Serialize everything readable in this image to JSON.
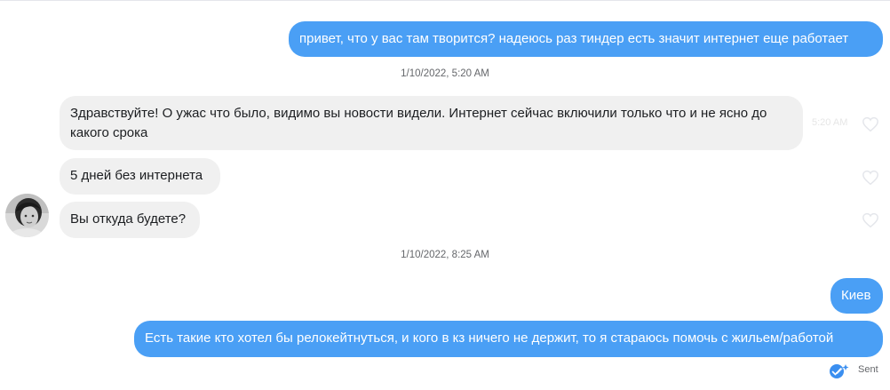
{
  "thread": {
    "messages": [
      {
        "direction": "outgoing",
        "text": "привет, что у вас там творится? надеюсь раз тиндер есть значит интернет еще работает"
      },
      {
        "type": "timestamp",
        "text": "1/10/2022, 5:20 AM"
      },
      {
        "direction": "incoming",
        "text": "Здравствуйте! О ужас что было, видимо вы новости видели. Интернет сейчас включили только что и не ясно до какого срока",
        "hover_time": "5:20 AM"
      },
      {
        "direction": "incoming",
        "text": "5 дней без интернета"
      },
      {
        "direction": "incoming",
        "text": "Вы откуда будете?"
      },
      {
        "type": "timestamp",
        "text": "1/10/2022, 8:25 AM"
      },
      {
        "direction": "outgoing",
        "text": "Киев"
      },
      {
        "direction": "outgoing",
        "text": "Есть такие кто хотел бы релокейтнуться, и кого в кз ничего не держит, то я стараюсь помочь с жильем/работой"
      }
    ],
    "status": {
      "label": "Sent",
      "icon": "double-check-icon"
    }
  },
  "colors": {
    "outgoing_bubble": "#4a9ff5",
    "incoming_bubble": "#f0f0f0",
    "timestamp_text": "#65676b",
    "status_icon": "#3b8ff0"
  }
}
